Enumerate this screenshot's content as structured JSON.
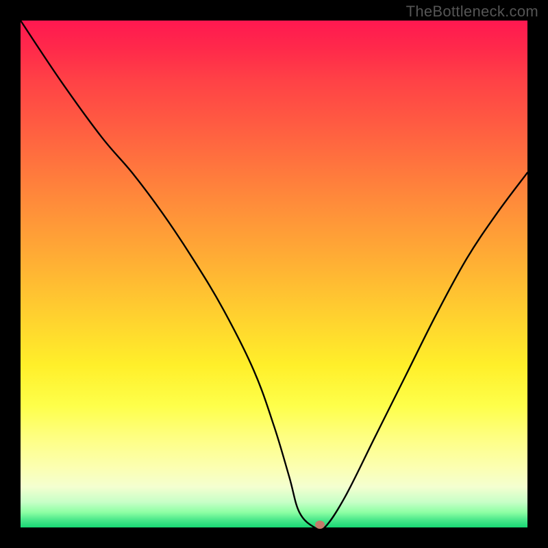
{
  "watermark": "TheBottleneck.com",
  "chart_data": {
    "type": "line",
    "title": "",
    "xlabel": "",
    "ylabel": "",
    "xlim": [
      0,
      100
    ],
    "ylim": [
      0,
      100
    ],
    "series": [
      {
        "name": "curve",
        "x": [
          0,
          8,
          16,
          22,
          28,
          34,
          40,
          46,
          50,
          53,
          55,
          58,
          60,
          64,
          70,
          76,
          82,
          88,
          94,
          100
        ],
        "values": [
          100,
          88,
          77,
          70,
          62,
          53,
          43,
          31,
          20,
          10,
          3,
          0,
          0,
          6,
          18,
          30,
          42,
          53,
          62,
          70
        ]
      }
    ],
    "marker": {
      "x": 59,
      "y": 0.5
    },
    "gradient_colors": {
      "top": "#ff1850",
      "mid": "#ffd62e",
      "bottom": "#18d874"
    }
  }
}
